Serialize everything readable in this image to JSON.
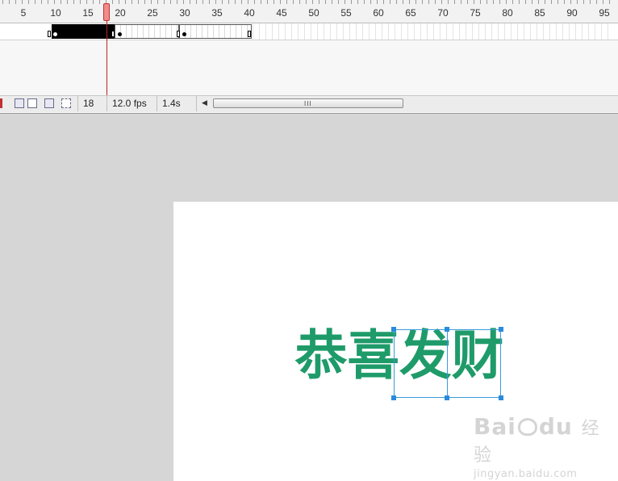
{
  "timeline": {
    "ruler_labels": [
      "5",
      "10",
      "15",
      "20",
      "25",
      "30",
      "35",
      "40",
      "45",
      "50",
      "55",
      "60",
      "65",
      "70",
      "75",
      "80",
      "85",
      "90",
      "95"
    ],
    "current_frame": 18
  },
  "status_bar": {
    "frame": "18",
    "fps": "12.0 fps",
    "time": "1.4s",
    "scroll_grip": "III"
  },
  "stage": {
    "text": "恭喜发财",
    "text_color": "#1f9b6a"
  },
  "watermark": {
    "logo_left": "Bai",
    "logo_right": "du",
    "logo_cn": "经验",
    "url": "jingyan.baidu.com"
  },
  "colors": {
    "selection": "#3a9bd9",
    "playhead": "#f28b8b"
  }
}
